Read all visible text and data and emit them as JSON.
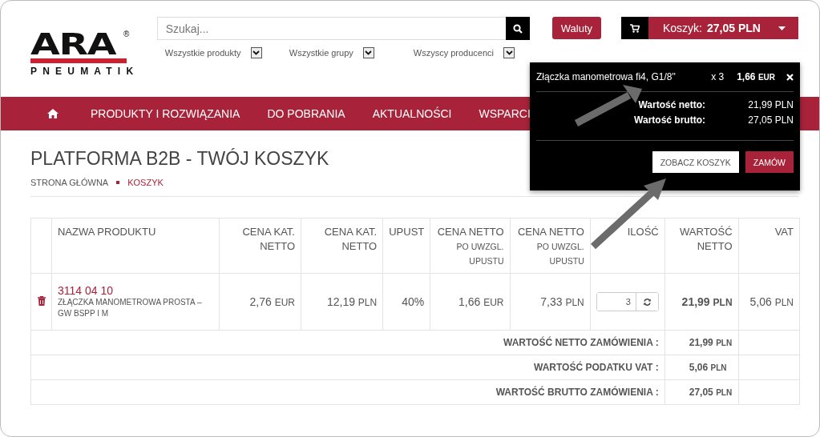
{
  "logo": {
    "wordmark": "ARA",
    "registered": "®",
    "tagline": "PNEUMATIK"
  },
  "search": {
    "placeholder": "Szukaj..."
  },
  "filters": [
    "Wszystkie produkty",
    "Wszystkie grupy",
    "Wszyscy producenci"
  ],
  "currency_button": "Waluty",
  "cart_button": {
    "label": "Koszyk:",
    "total": "27,05 PLN"
  },
  "nav": [
    {
      "kind": "home"
    },
    {
      "kind": "link",
      "label": "PRODUKTY I ROZWIĄZANIA"
    },
    {
      "kind": "link",
      "label": "DO POBRANIA"
    },
    {
      "kind": "link",
      "label": "AKTUALNOŚCI"
    },
    {
      "kind": "link",
      "label": "WSPARCI"
    }
  ],
  "page_title": "PLATFORMA B2B - TWÓJ KOSZYK",
  "breadcrumbs": [
    {
      "label": "STRONA GŁÓWNA",
      "selected": false
    },
    {
      "label": "KOSZYK",
      "selected": true
    }
  ],
  "table": {
    "columns": [
      {},
      {
        "title": "NAZWA PRODUKTU"
      },
      {
        "title": "CENA KAT. NETTO"
      },
      {
        "title": "CENA KAT. NETTO"
      },
      {
        "title": "UPUST"
      },
      {
        "title": "CENA NETTO",
        "note": "PO UWZGL. UPUSTU"
      },
      {
        "title": "CENA NETTO",
        "note": "PO UWZGL. UPUSTU"
      },
      {
        "title": "ILOŚĆ"
      },
      {
        "title": "WARTOŚĆ NETTO"
      },
      {
        "title": "VAT"
      }
    ],
    "rows": [
      {
        "cells": [
          {
            "kind": "delete"
          },
          {
            "kind": "product",
            "code": "3114 04 10",
            "name": "ZŁĄCZKA MANOMETROWA PROSTA – GW BSPP I M"
          },
          {
            "kind": "price",
            "amount": "2,76",
            "currency": "EUR"
          },
          {
            "kind": "price",
            "amount": "12,19",
            "currency": "PLN"
          },
          {
            "kind": "price",
            "amount": "40%"
          },
          {
            "kind": "price",
            "amount": "1,66",
            "currency": "EUR"
          },
          {
            "kind": "price",
            "amount": "7,33",
            "currency": "PLN"
          },
          {
            "kind": "quantity",
            "value": "3"
          },
          {
            "kind": "total",
            "amount": "21,99",
            "currency": "PLN"
          },
          {
            "kind": "price",
            "amount": "5,06",
            "currency": "PLN"
          }
        ]
      }
    ],
    "totals": [
      {
        "label": "WARTOŚĆ NETTO ZAMÓWIENIA :",
        "amount": "21,99",
        "currency": "PLN"
      },
      {
        "label": "WARTOŚĆ PODATKU VAT :",
        "amount": "5,06",
        "currency": "PLN"
      },
      {
        "label": "WARTOŚĆ BRUTTO ZAMÓWIENIA :",
        "amount": "27,05",
        "currency": "PLN"
      }
    ]
  },
  "cart_popup": {
    "items": [
      {
        "name": "Złączka manometrowa fi4, G1/8\"",
        "quantity": "x 3",
        "price": "1,66",
        "currency": "EUR"
      }
    ],
    "summary": [
      {
        "label": "Wartość netto:",
        "value": "21,99 PLN"
      },
      {
        "label": "Wartość brutto:",
        "value": "27,05 PLN"
      }
    ],
    "buttons": [
      {
        "label": "ZOBACZ KOSZYK",
        "kind": "secondary"
      },
      {
        "label": "ZAMÓW",
        "kind": "primary"
      }
    ]
  }
}
